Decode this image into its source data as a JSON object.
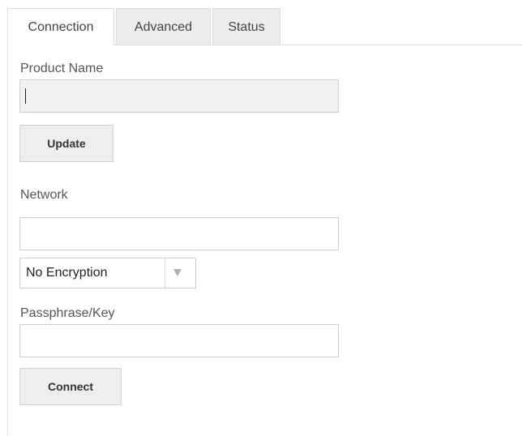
{
  "tabs": {
    "connection": "Connection",
    "advanced": "Advanced",
    "status": "Status"
  },
  "product": {
    "label": "Product Name",
    "value": ""
  },
  "update_button": "Update",
  "network": {
    "label": "Network",
    "value": ""
  },
  "encryption": {
    "selected": "No Encryption",
    "icon": "chevron-down-icon"
  },
  "passphrase": {
    "label": "Passphrase/Key",
    "value": ""
  },
  "connect_button": "Connect"
}
